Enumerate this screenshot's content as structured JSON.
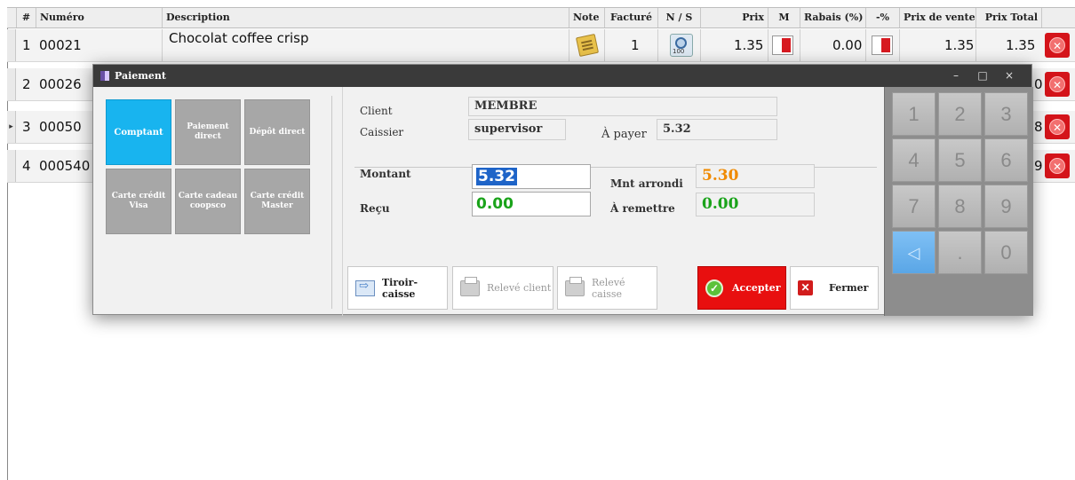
{
  "grid": {
    "headers": {
      "hash": "#",
      "numero": "Numéro",
      "description": "Description",
      "note": "Note",
      "facture": "Facturé",
      "ns": "N / S",
      "prix": "Prix",
      "m": "M",
      "rabais": "Rabais (%)",
      "minus_pct": "-%",
      "prix_vente": "Prix de vente",
      "prix_total": "Prix Total"
    },
    "rows": [
      {
        "index": "1",
        "numero": "00021",
        "description": "Chocolat coffee crisp",
        "facture": "1",
        "prix": "1.35",
        "rabais": "0.00",
        "prix_vente": "1.35",
        "prix_total": "1.35",
        "marker": ""
      },
      {
        "index": "2",
        "numero": "00026",
        "total_partial": "0",
        "marker": ""
      },
      {
        "index": "3",
        "numero": "00050",
        "total_partial": "8",
        "marker": "▸"
      },
      {
        "index": "4",
        "numero": "000540",
        "total_partial": "9",
        "marker": ""
      }
    ]
  },
  "dialog": {
    "title": "Paiement",
    "controls": {
      "minimize": "–",
      "maximize": "□",
      "close": "×"
    },
    "tiles": [
      {
        "label": "Comptant",
        "active": true
      },
      {
        "label": "Paiement direct",
        "active": false
      },
      {
        "label": "Dépôt direct",
        "active": false
      },
      {
        "label": "Carte crédit Visa",
        "active": false
      },
      {
        "label": "Carte cadeau coopsco",
        "active": false
      },
      {
        "label": "Carte crédit Master",
        "active": false
      }
    ],
    "info": {
      "client_label": "Client",
      "client_value": "MEMBRE",
      "caissier_label": "Caissier",
      "caissier_value": "supervisor",
      "a_payer_label": "À payer",
      "a_payer_value": "5.32",
      "montant_label": "Montant",
      "montant_value": "5.32",
      "recu_label": "Reçu",
      "recu_value": "0.00",
      "mnt_arrondi_label": "Mnt arrondi",
      "mnt_arrondi_value": "5.30",
      "a_remettre_label": "À remettre",
      "a_remettre_value": "0.00"
    },
    "buttons": {
      "tiroir": "Tiroir-caisse",
      "releve_client": "Relevé client",
      "releve_caisse": "Relevé caisse",
      "accepter": "Accepter",
      "fermer": "Fermer"
    },
    "keypad": [
      "1",
      "2",
      "3",
      "4",
      "5",
      "6",
      "7",
      "8",
      "9",
      "◁",
      ".",
      "0"
    ]
  },
  "colors": {
    "active_tile": "#18b4ef",
    "accept": "#e80f0f",
    "recu_green": "#1aa31a",
    "arrondi_orange": "#f08a00",
    "montant_selection": "#1e64c8"
  }
}
